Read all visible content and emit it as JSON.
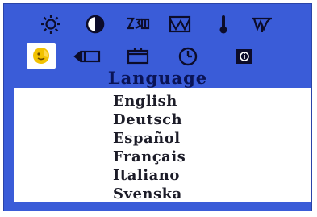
{
  "osd": {
    "title": "Language",
    "tabs_row1": [
      {
        "icon": "brightness-icon"
      },
      {
        "icon": "contrast-icon"
      },
      {
        "icon": "geometry-icon"
      },
      {
        "icon": "waveform-icon"
      },
      {
        "icon": "color-temperature-icon"
      },
      {
        "icon": "degauss-icon"
      }
    ],
    "tabs_row2": [
      {
        "icon": "language-face-icon",
        "selected": true
      },
      {
        "icon": "input-signal-icon"
      },
      {
        "icon": "screen-position-icon"
      },
      {
        "icon": "clock-icon"
      },
      {
        "icon": "information-icon"
      }
    ],
    "languages": [
      "English",
      "Deutsch",
      "Español",
      "Français",
      "Italiano",
      "Svenska"
    ]
  },
  "colors": {
    "osd_background": "#3a5cd8",
    "panel_background": "#ffffff",
    "title_text": "#0a1456",
    "option_text": "#1c1c28",
    "icon_color": "#0c0c2a",
    "selected_icon_highlight": "#ffffff",
    "selected_icon_face": "#f2c200"
  }
}
